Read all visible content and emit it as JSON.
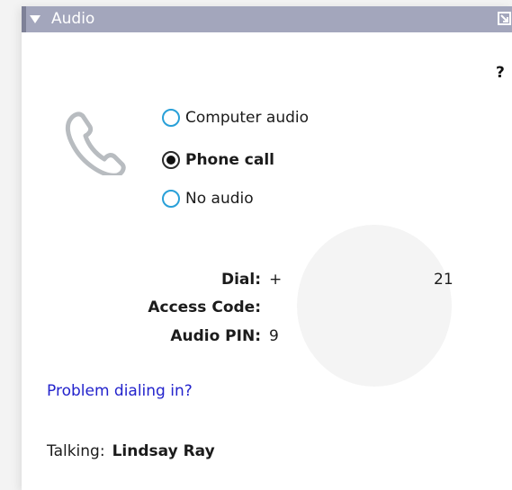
{
  "panel": {
    "title": "Audio"
  },
  "help_label": "?",
  "audio_options": [
    {
      "label": "Computer audio",
      "selected": false
    },
    {
      "label": "Phone call",
      "selected": true
    },
    {
      "label": "No audio",
      "selected": false
    }
  ],
  "dial_info": {
    "dial_label": "Dial:",
    "dial_value_start": "+",
    "dial_value_end": "21",
    "access_code_label": "Access Code:",
    "audio_pin_label": "Audio PIN:",
    "audio_pin_value_start": "9"
  },
  "problem_link": "Problem dialing in?",
  "talking": {
    "label": "Talking:",
    "name": "Lindsay Ray"
  },
  "colors": {
    "titlebar": "#a3a6bc",
    "radio_accent": "#29a0d8",
    "link": "#2323cc"
  }
}
